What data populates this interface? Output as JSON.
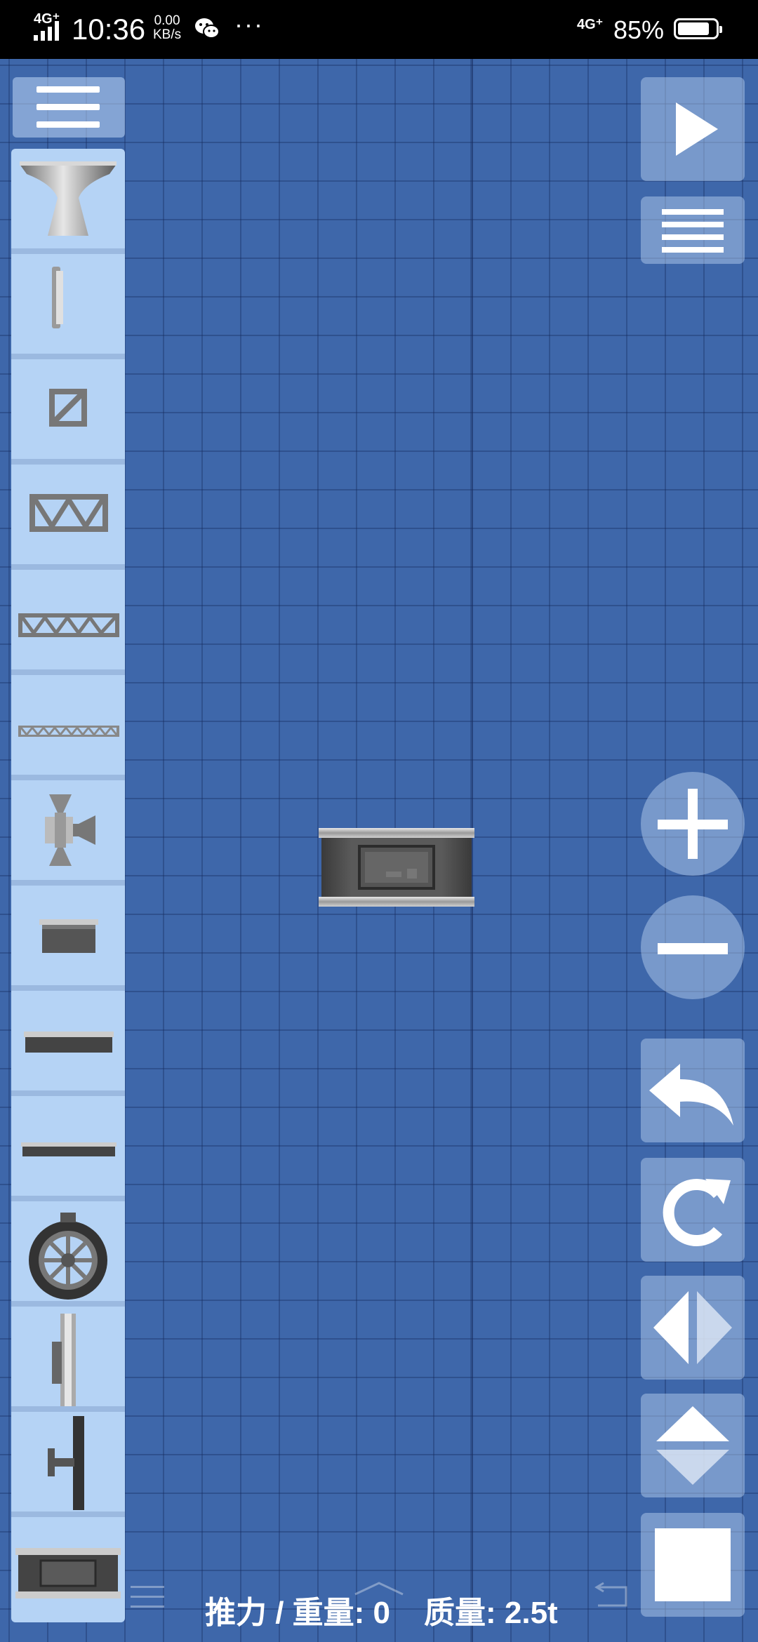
{
  "status_bar": {
    "network": "4G⁺",
    "time": "10:36",
    "speed_value": "0.00",
    "speed_unit": "KB/s",
    "more": "···",
    "network_right": "4G⁺",
    "battery_percent": "85%",
    "battery_level": 0.85
  },
  "left_panel": {
    "menu_icon": "hamburger-menu-icon",
    "parts": [
      "engine-nozzle-icon",
      "side-panel-icon",
      "small-square-frame-icon",
      "medium-truss-frame-icon",
      "long-truss-icon",
      "thin-truss-icon",
      "rcs-thruster-icon",
      "fuel-tank-small-icon",
      "flat-plate-icon",
      "thin-plate-icon",
      "wheel-icon",
      "parachute-side-icon",
      "strut-arm-icon",
      "fuel-tank-large-icon"
    ]
  },
  "right_toolbar": {
    "play_icon": "play-icon",
    "list_icon": "list-menu-icon",
    "zoom_in_icon": "plus-icon",
    "zoom_out_icon": "minus-icon",
    "undo_icon": "undo-icon",
    "redo_icon": "redo-icon",
    "flip_h_icon": "flip-horizontal-icon",
    "flip_v_icon": "flip-vertical-icon",
    "select_icon": "square-icon"
  },
  "canvas": {
    "placed_part": "fuel-tank-large-icon"
  },
  "stats": {
    "thrust_weight": "推力 / 重量: 0",
    "mass": "质量: 2.5t"
  },
  "colors": {
    "blueprint": "#3e67aa",
    "panel": "#b5d3f5",
    "status_bar": "#000000"
  }
}
